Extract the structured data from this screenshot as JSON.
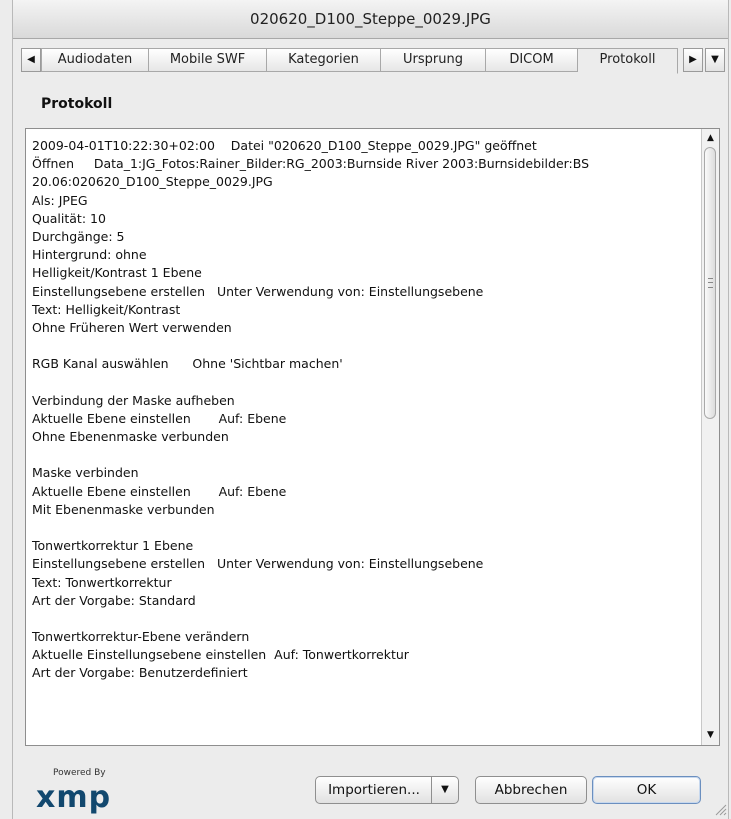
{
  "window": {
    "title": "020620_D100_Steppe_0029.JPG"
  },
  "tabs": {
    "left_arrow": "◀",
    "right_arrow": "▶",
    "menu_arrow": "▼",
    "items": [
      "Audiodaten",
      "Mobile SWF",
      "Kategorien",
      "Ursprung",
      "DICOM",
      "Protokoll"
    ],
    "active": "Protokoll"
  },
  "section": {
    "title": "Protokoll"
  },
  "log": {
    "lines": [
      "2009-04-01T10:22:30+02:00    Datei \"020620_D100_Steppe_0029.JPG\" geöffnet",
      "Öffnen     Data_1:JG_Fotos:Rainer_Bilder:RG_2003:Burnside River 2003:Burnsidebilder:BS",
      "20.06:020620_D100_Steppe_0029.JPG",
      "Als: JPEG",
      "Qualität: 10",
      "Durchgänge: 5",
      "Hintergrund: ohne",
      "Helligkeit/Kontrast 1 Ebene",
      "Einstellungsebene erstellen   Unter Verwendung von: Einstellungsebene",
      "Text: Helligkeit/Kontrast",
      "Ohne Früheren Wert verwenden",
      "",
      "RGB Kanal auswählen      Ohne 'Sichtbar machen'",
      "",
      "Verbindung der Maske aufheben",
      "Aktuelle Ebene einstellen       Auf: Ebene",
      "Ohne Ebenenmaske verbunden",
      "",
      "Maske verbinden",
      "Aktuelle Ebene einstellen       Auf: Ebene",
      "Mit Ebenenmaske verbunden",
      "",
      "Tonwertkorrektur 1 Ebene",
      "Einstellungsebene erstellen   Unter Verwendung von: Einstellungsebene",
      "Text: Tonwertkorrektur",
      "Art der Vorgabe: Standard",
      "",
      "Tonwertkorrektur-Ebene verändern",
      "Aktuelle Einstellungsebene einstellen  Auf: Tonwertkorrektur",
      "Art der Vorgabe: Benutzerdefiniert"
    ],
    "scroll_up": "▲",
    "scroll_down": "▼"
  },
  "footer": {
    "powered_by": "Powered By",
    "logo_text": "xmp",
    "import_label": "Importieren...",
    "import_menu_arrow": "▼",
    "cancel_label": "Abbrechen",
    "ok_label": "OK"
  }
}
